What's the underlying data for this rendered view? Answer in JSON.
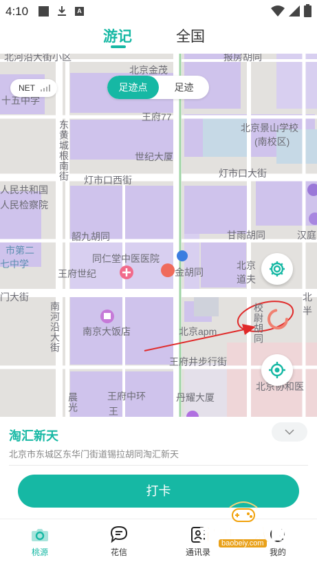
{
  "status_bar": {
    "time": "4:10",
    "icons": [
      "notification-square-icon",
      "download-icon",
      "a-icon",
      "wifi-icon",
      "signal-icon",
      "battery-icon"
    ]
  },
  "top_tabs": [
    {
      "label": "游记",
      "active": true
    },
    {
      "label": "全国",
      "active": false
    }
  ],
  "map": {
    "network_label": "NET",
    "segment": {
      "options": [
        "足迹点",
        "足迹"
      ],
      "selected": "足迹点"
    },
    "labels": [
      {
        "text": "北河沿大街小区"
      },
      {
        "text": "北京金茂"
      },
      {
        "text": "报房胡同"
      },
      {
        "text": "十五中学"
      },
      {
        "text": "王府77"
      },
      {
        "text": "东黄城根南街"
      },
      {
        "text": "北京景山学校"
      },
      {
        "text": "(南校区)"
      },
      {
        "text": "世纪大厦"
      },
      {
        "text": "灯市口西街"
      },
      {
        "text": "灯市口大街"
      },
      {
        "text": "人民共和国"
      },
      {
        "text": "人民检察院"
      },
      {
        "text": "市第二"
      },
      {
        "text": "七中学"
      },
      {
        "text": "韶九胡同"
      },
      {
        "text": "甘雨胡同"
      },
      {
        "text": "汉庭"
      },
      {
        "text": "同仁堂中医医院"
      },
      {
        "text": "王府世纪"
      },
      {
        "text": "金胡同"
      },
      {
        "text": "北京"
      },
      {
        "text": "道夫"
      },
      {
        "text": "门大街"
      },
      {
        "text": "南河沿大街"
      },
      {
        "text": "校尉胡同"
      },
      {
        "text": "北"
      },
      {
        "text": "半"
      },
      {
        "text": "南京大饭店"
      },
      {
        "text": "北京apm"
      },
      {
        "text": "王府井步行街"
      },
      {
        "text": "晨光"
      },
      {
        "text": "王府中环"
      },
      {
        "text": "丹耀大厦"
      },
      {
        "text": "北京协和医"
      },
      {
        "text": "王"
      }
    ]
  },
  "place": {
    "name": "淘汇新天",
    "address": "北京市东城区东华门街道锡拉胡同淘汇新天"
  },
  "checkin_label": "打卡",
  "bottom_nav": [
    {
      "label": "桃源",
      "icon": "camera-icon",
      "active": true
    },
    {
      "label": "花信",
      "icon": "chat-bubble-icon",
      "active": false
    },
    {
      "label": "通讯录",
      "icon": "contacts-icon",
      "active": false
    },
    {
      "label": "我的",
      "icon": "profile-icon",
      "active": false
    }
  ],
  "watermark": {
    "title": "宝贝游戏网",
    "url": "baobeiy.com"
  },
  "colors": {
    "accent": "#16b8a4",
    "annotation_red": "#e02a2a"
  }
}
